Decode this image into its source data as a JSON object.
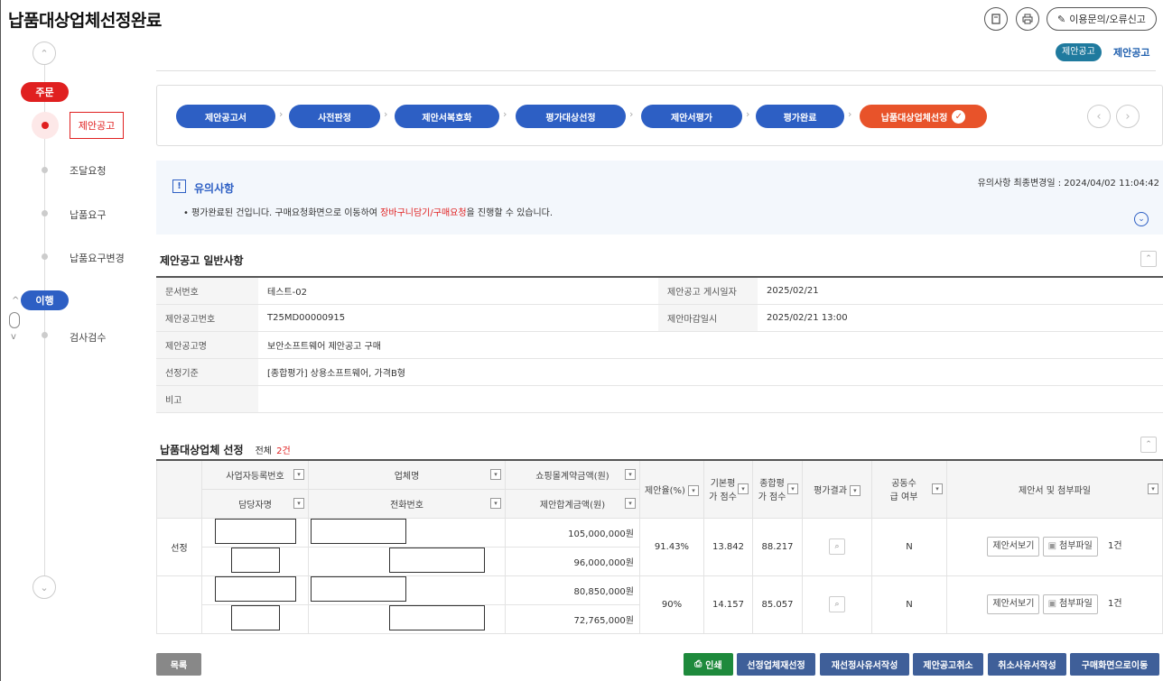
{
  "header": {
    "title": "납품대상업체선정완료",
    "inquiry": "이용문의/오류신고",
    "mini_badge": "제안공고",
    "mini_label": "제안공고"
  },
  "sidebar": {
    "group1": "주문",
    "group2": "이행",
    "items": [
      "제안공고",
      "조달요청",
      "납품요구",
      "납품요구변경"
    ],
    "items2": [
      "검사검수"
    ]
  },
  "steps": [
    "제안공고서",
    "사전판정",
    "제안서복호화",
    "평가대상선정",
    "제안서평가",
    "평가완료",
    "납품대상업체선정"
  ],
  "notice": {
    "title": "유의사항",
    "updated": "유의사항 최종변경일 : 2024/04/02 11:04:42",
    "text_before": "• 평가완료된 건입니다. 구매요청화면으로 이동하여 ",
    "text_highlight": "장바구니담기/구매요청",
    "text_after": "을 진행할 수 있습니다."
  },
  "general": {
    "title": "제안공고 일반사항",
    "doc_no_label": "문서번호",
    "doc_no": "테스트-02",
    "post_date_label": "제안공고 게시일자",
    "post_date": "2025/02/21",
    "notice_no_label": "제안공고번호",
    "notice_no": "T25MD00000915",
    "deadline_label": "제안마감일시",
    "deadline": "2025/02/21 13:00",
    "name_label": "제안공고명",
    "name": "보안소프트웨어 제안공고 구매",
    "criteria_label": "선정기준",
    "criteria": "[종합평가] 상용소프트웨어, 가격B형",
    "remark_label": "비고",
    "remark": ""
  },
  "vendors": {
    "title": "납품대상업체 선정",
    "total_label": "전체",
    "total_count": "2건",
    "headers": {
      "biz_no": "사업자등록번호",
      "manager": "담당자명",
      "company": "업체명",
      "phone": "전화번호",
      "mall_amt": "쇼핑몰계약금액(원)",
      "proposal_amt": "제안합계금액(원)",
      "rate": "제안율(%)",
      "base_score": "기본평가 점수",
      "total_score": "종합평가 점수",
      "result": "평가결과",
      "joint": "공동수급 여부",
      "files": "제안서 및 첨부파일"
    },
    "rows": [
      {
        "status": "선정",
        "mall_amt": "105,000,000원",
        "proposal_amt": "96,000,000원",
        "rate": "91.43%",
        "base_score": "13.842",
        "total_score": "88.217",
        "joint": "N",
        "view": "제안서보기",
        "attach": "첨부파일",
        "count": "1건"
      },
      {
        "status": "",
        "mall_amt": "80,850,000원",
        "proposal_amt": "72,765,000원",
        "rate": "90%",
        "base_score": "14.157",
        "total_score": "85.057",
        "joint": "N",
        "view": "제안서보기",
        "attach": "첨부파일",
        "count": "1건"
      }
    ]
  },
  "buttons": {
    "list": "목록",
    "print": "인쇄",
    "reselect": "선정업체재선정",
    "reselect_reason": "재선정사유서작성",
    "cancel": "제안공고취소",
    "cancel_reason": "취소사유서작성",
    "goto_buy": "구매화면으로이동"
  },
  "colors": {
    "accent": "#2d5fc4",
    "active": "#e8532a",
    "red": "#e02020",
    "teal": "#1f7a9e",
    "green": "#1e8a3c",
    "gray_btn": "#888888",
    "navy_btn": "#3f5f99"
  }
}
